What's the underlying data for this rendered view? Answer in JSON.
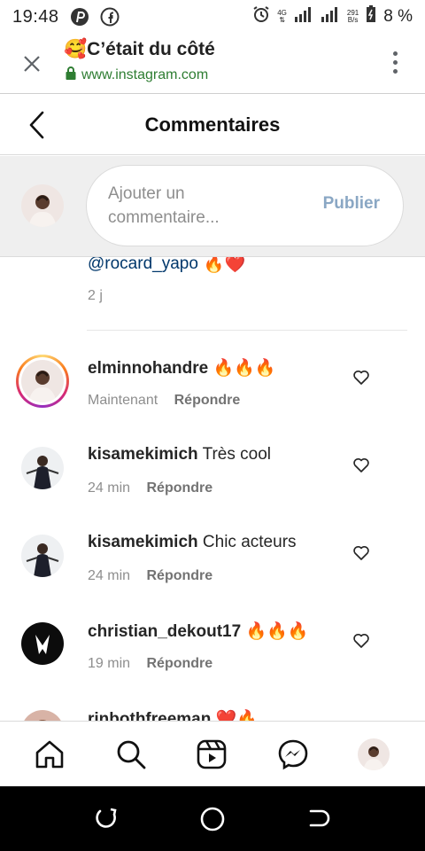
{
  "status_bar": {
    "time": "19:48",
    "network": "4G",
    "speed_value": "291",
    "speed_unit": "B/s",
    "battery": "8 %"
  },
  "browser": {
    "title_emoji": "🥰",
    "title": "C’était du côté",
    "url": "www.instagram.com"
  },
  "header": {
    "title": "Commentaires"
  },
  "composer": {
    "placeholder": "Ajouter un commentaire...",
    "publish_label": "Publier"
  },
  "previous_comment": {
    "text": "@rocard_yapo",
    "emojis": "🔥❤️",
    "time": "2 j"
  },
  "comments": [
    {
      "user": "elminnohandre",
      "text": "",
      "emojis": "🔥🔥🔥",
      "time": "Maintenant",
      "reply_label": "Répondre"
    },
    {
      "user": "kisamekimich",
      "text": "Très cool",
      "emojis": "",
      "time": "24 min",
      "reply_label": "Répondre"
    },
    {
      "user": "kisamekimich",
      "text": "Chic acteurs",
      "emojis": "",
      "time": "24 min",
      "reply_label": "Répondre"
    },
    {
      "user": "christian_dekout17",
      "text": "",
      "emojis": "🔥🔥🔥",
      "time": "19 min",
      "reply_label": "Répondre"
    }
  ],
  "partial_comment": {
    "user": "rinbothfreeman",
    "emojis": "❤️🔥"
  },
  "bottom_nav": [
    "home-icon",
    "search-icon",
    "reels-icon",
    "messenger-icon",
    "profile-avatar"
  ],
  "colors": {
    "accent_link": "#00376b",
    "publish_disabled": "#8aa7c4",
    "secure_green": "#2e7d32"
  }
}
